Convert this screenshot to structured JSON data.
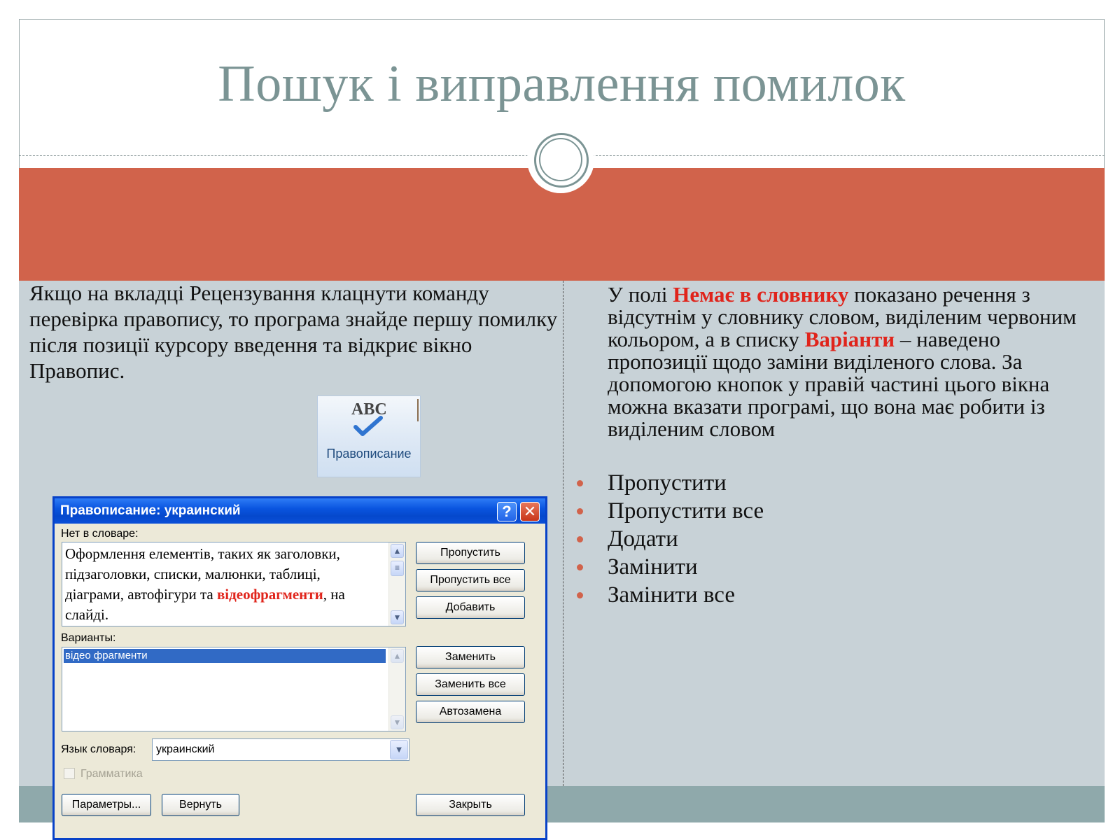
{
  "slide": {
    "title": "Пошук і виправлення помилок",
    "left_paragraph": "Якщо на  вкладці Рецензування клацнути команду перевірка правопису, то програма знайде першу помилку після позиції курсору  введення та відкриє вікно Правопис.",
    "right_paragraph": {
      "part1": "У полі ",
      "hl1": "Немає в словнику",
      "part2": " показано речення з відсутнім у словнику словом, виділеним червоним кольором, а в списку ",
      "hl2": "Варіанти",
      "part3": " – наведено пропозиції щодо заміни виділеного слова. За допомогою кнопок  у правій частині цього вікна можна вказати програмі, що вона має робити із виділеним словом"
    },
    "bullets": [
      "Пропустити",
      "Пропустити все",
      "Додати",
      "Замінити",
      "Замінити все"
    ],
    "colors": {
      "title": "#7b9494",
      "band": "#d1634b",
      "content_bg": "#c8d2d7",
      "footer": "#8fa9ab",
      "highlight": "#e0241b"
    }
  },
  "ribbon_button": {
    "icon_text": "ABC",
    "icon": "spellcheck-checkmark-icon",
    "label": "Правописание"
  },
  "dialog": {
    "title": "Правописание: украинский",
    "help_button": "?",
    "close_button": "✕",
    "not_in_dict_label": "Нет в словаре:",
    "sentence": {
      "before": "Оформлення елементів, таких як заголовки, підзаголовки, списки, малюнки, таблиці, діаграми, автофігури та ",
      "error_word": "відеофрагменти",
      "after": ", на слайді."
    },
    "variants_label": "Варианты:",
    "variants": [
      "відео фрагменти"
    ],
    "language_label": "Язык словаря:",
    "language_value": "украинский",
    "grammar_label": "Грамматика",
    "buttons": {
      "skip": "Пропустить",
      "skip_all": "Пропустить все",
      "add": "Добавить",
      "replace": "Заменить",
      "replace_all": "Заменить все",
      "autocorrect": "Автозамена",
      "params": "Параметры...",
      "undo": "Вернуть",
      "close": "Закрыть"
    }
  }
}
